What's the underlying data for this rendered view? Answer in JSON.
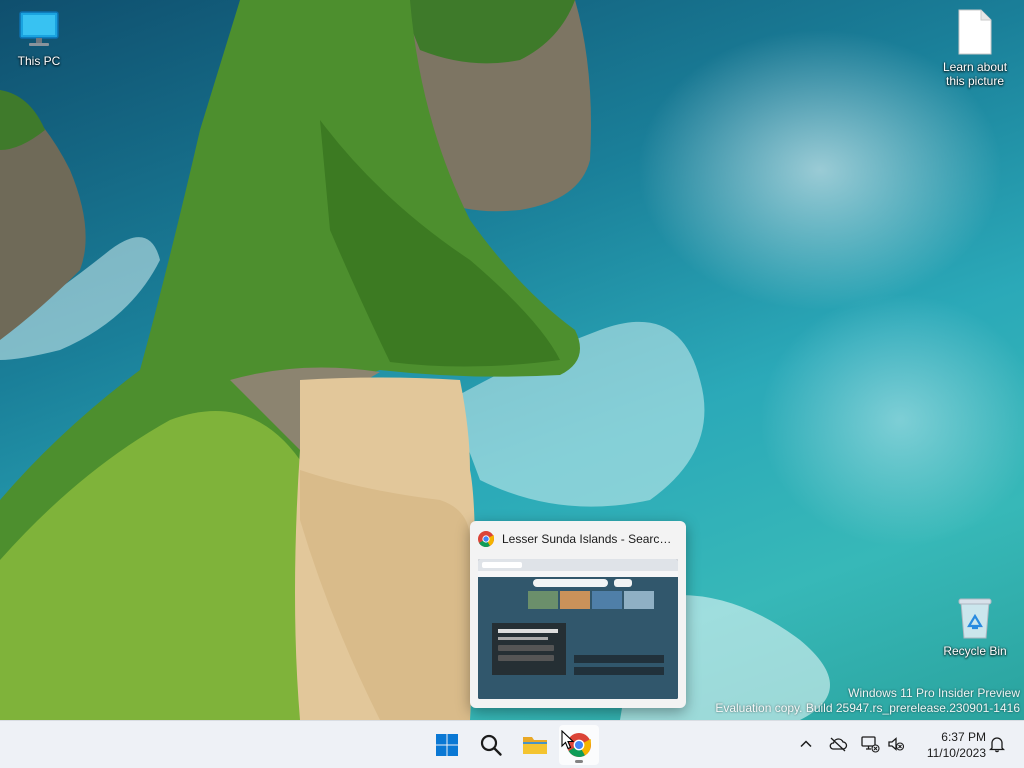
{
  "desktop": {
    "icons": [
      {
        "label": "This PC",
        "icon": "monitor-icon"
      },
      {
        "label": "Learn about this picture",
        "icon": "document-icon"
      },
      {
        "label": "Recycle Bin",
        "icon": "recycle-bin-icon"
      }
    ],
    "watermark": {
      "line1": "Windows 11 Pro Insider Preview",
      "line2": "Evaluation copy. Build 25947.rs_prerelease.230901-1416"
    }
  },
  "preview": {
    "title": "Lesser Sunda Islands - Search - ...",
    "app_icon": "chrome-icon"
  },
  "taskbar": {
    "apps": [
      {
        "name": "Start",
        "icon": "windows-start-icon"
      },
      {
        "name": "Search",
        "icon": "search-icon"
      },
      {
        "name": "File Explorer",
        "icon": "folder-icon"
      },
      {
        "name": "Google Chrome",
        "icon": "chrome-icon",
        "active": true
      }
    ],
    "tray": {
      "icons": [
        "chevron-up-icon",
        "onedrive-offline-icon",
        "network-offline-icon",
        "speaker-muted-icon",
        "notification-bell-icon"
      ],
      "time": "6:37 PM",
      "date": "11/10/2023"
    }
  },
  "colors": {
    "taskbar_bg": "#eef1f6",
    "windows_blue": "#0a78d4",
    "folder_yellow": "#f4c430"
  }
}
